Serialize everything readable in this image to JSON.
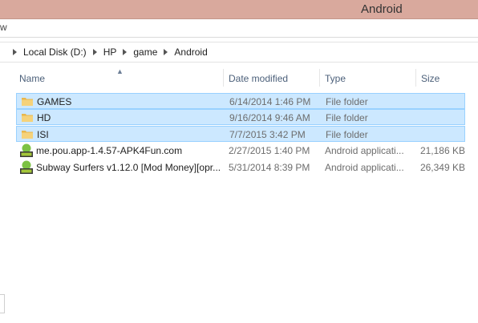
{
  "window": {
    "title": "Android"
  },
  "ribbon": {
    "fragment": "w"
  },
  "breadcrumb": [
    "Local Disk (D:)",
    "HP",
    "game",
    "Android"
  ],
  "columns": {
    "name": "Name",
    "date": "Date modified",
    "type": "Type",
    "size": "Size"
  },
  "files": [
    {
      "name": "GAMES",
      "date": "6/14/2014 1:46 PM",
      "type": "File folder",
      "size": "",
      "icon": "folder-icon",
      "selected": true
    },
    {
      "name": "HD",
      "date": "9/16/2014 9:46 AM",
      "type": "File folder",
      "size": "",
      "icon": "folder-icon",
      "selected": true
    },
    {
      "name": "ISI",
      "date": "7/7/2015 3:42 PM",
      "type": "File folder",
      "size": "",
      "icon": "folder-icon",
      "selected": true
    },
    {
      "name": "me.pou.app-1.4.57-APK4Fun.com",
      "date": "2/27/2015 1:40 PM",
      "type": "Android applicati...",
      "size": "21,186 KB",
      "icon": "apk-icon",
      "selected": false
    },
    {
      "name": "Subway Surfers v1.12.0 [Mod Money][opr...",
      "date": "5/31/2014 8:39 PM",
      "type": "Android applicati...",
      "size": "26,349 KB",
      "icon": "apk-icon",
      "selected": false
    }
  ]
}
